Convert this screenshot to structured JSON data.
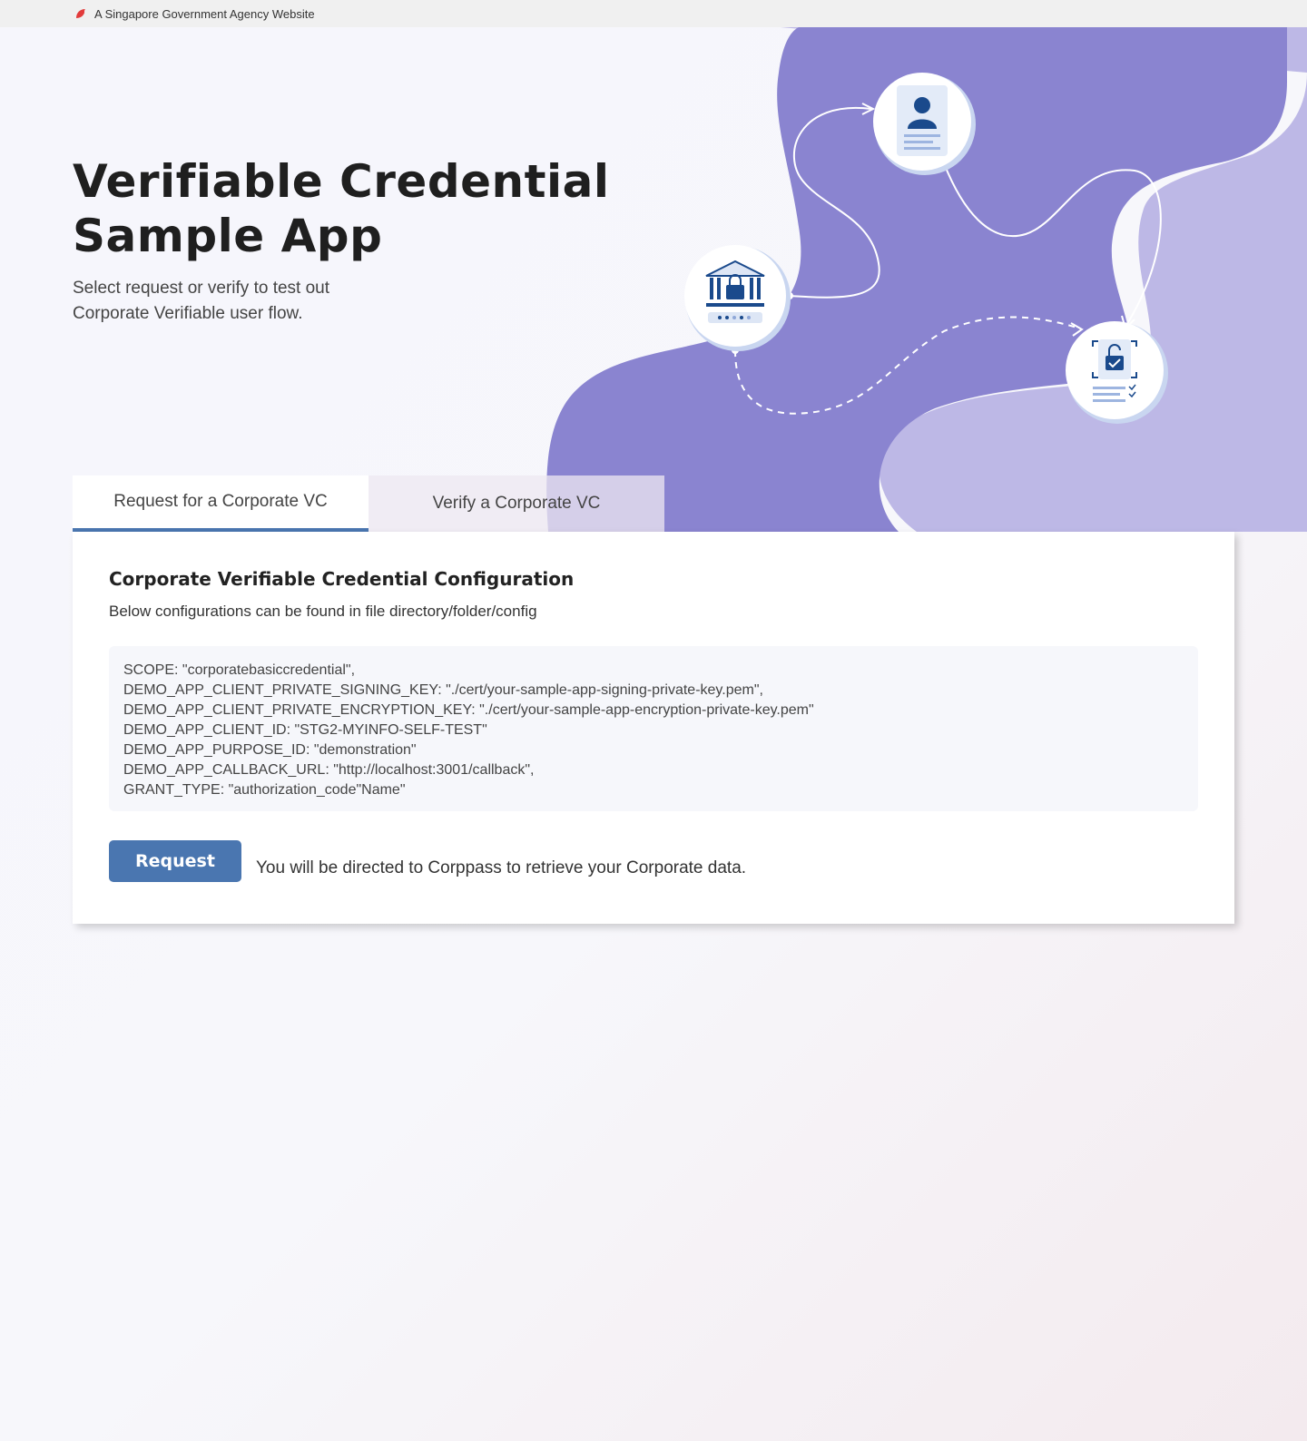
{
  "masthead": {
    "text": "A Singapore Government Agency Website"
  },
  "hero": {
    "title_line1": "Verifiable Credential",
    "title_line2": "Sample App",
    "subtitle": "Select request or verify to test out Corporate Verifiable user flow."
  },
  "tabs": [
    {
      "label": "Request for a Corporate VC",
      "active": true
    },
    {
      "label": "Verify a Corporate VC",
      "active": false
    }
  ],
  "panel": {
    "heading": "Corporate Verifiable Credential Configuration",
    "description": "Below configurations can be found in file directory/folder/config",
    "config_lines": [
      "SCOPE: \"corporatebasiccredential\",",
      "DEMO_APP_CLIENT_PRIVATE_SIGNING_KEY: \"./cert/your-sample-app-signing-private-key.pem\",",
      "DEMO_APP_CLIENT_PRIVATE_ENCRYPTION_KEY: \"./cert/your-sample-app-encryption-private-key.pem\"",
      "DEMO_APP_CLIENT_ID: \"STG2-MYINFO-SELF-TEST\"",
      "DEMO_APP_PURPOSE_ID: \"demonstration\"",
      "DEMO_APP_CALLBACK_URL: \"http://localhost:3001/callback\",",
      "GRANT_TYPE: \"authorization_code\"Name\""
    ],
    "button_label": "Request",
    "note": "You will be directed to Corppass to retrieve your Corporate data."
  },
  "colors": {
    "accent": "#4a76b0",
    "hero_purple": "#8a84d0",
    "hero_purple_light": "#bdb8e6",
    "icon_blue": "#1a4a8c"
  },
  "icons": [
    "lion-logo-icon",
    "bank-lock-icon",
    "person-card-icon",
    "unlock-document-icon"
  ]
}
